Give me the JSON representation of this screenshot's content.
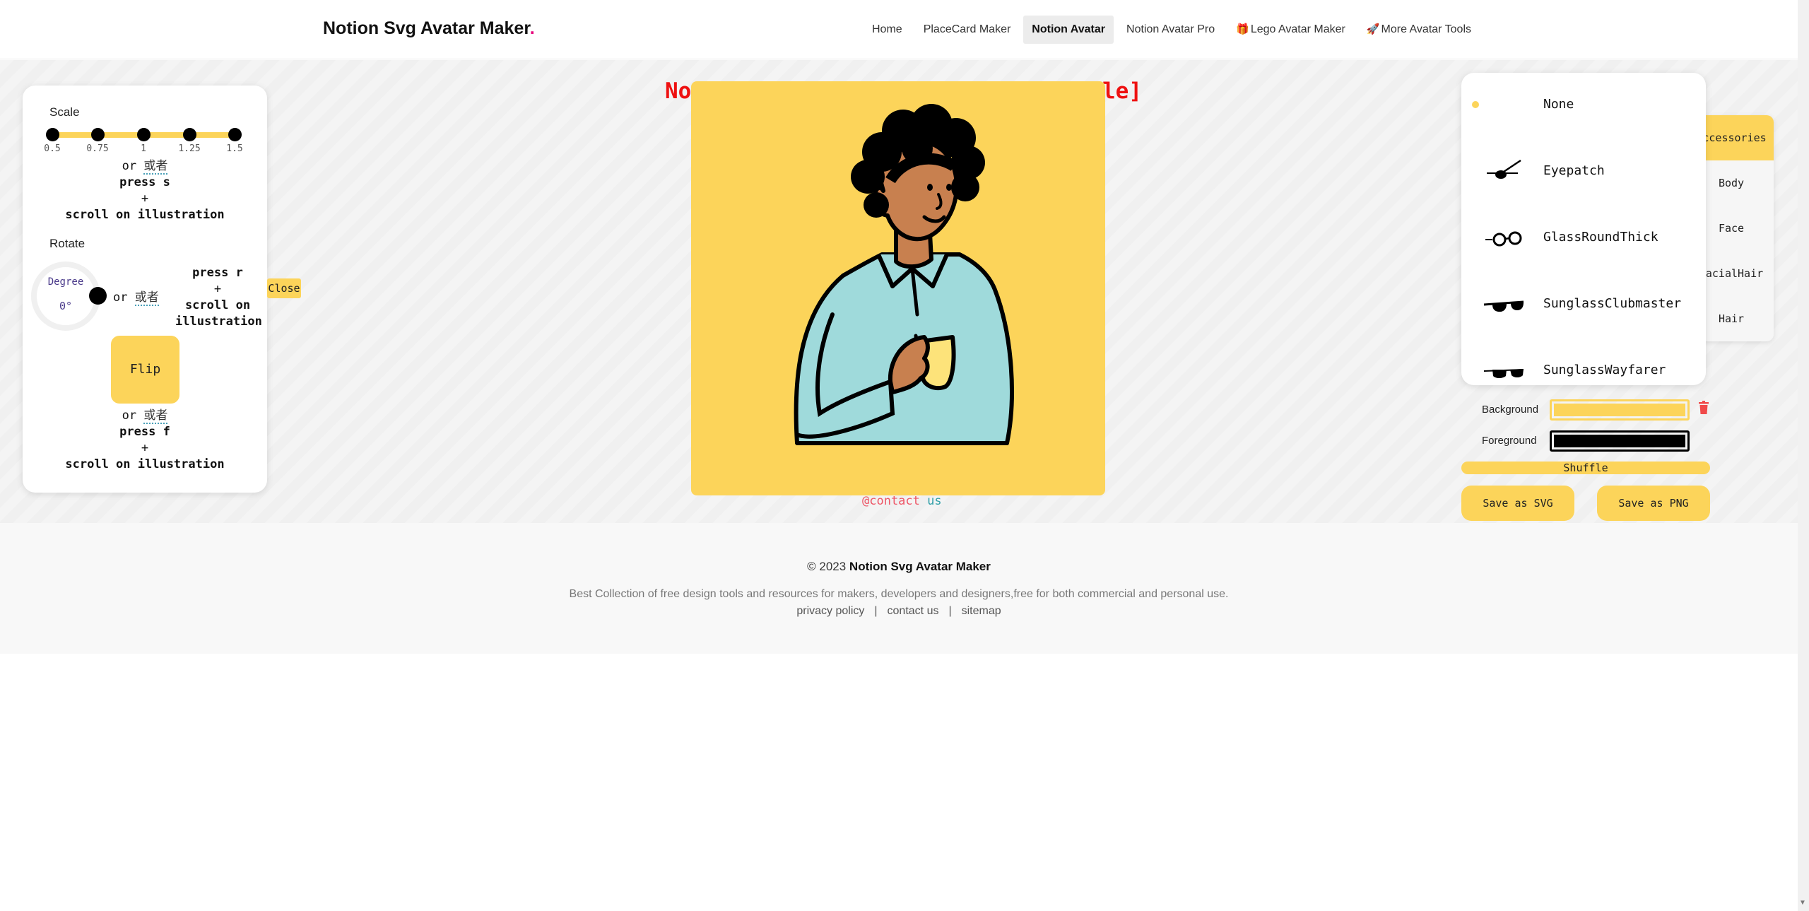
{
  "header": {
    "logo": "Notion Svg Avatar Maker",
    "logo_dot": ".",
    "nav": [
      {
        "label": "Home",
        "icon": ""
      },
      {
        "label": "PlaceCard Maker",
        "icon": ""
      },
      {
        "label": "Notion Avatar",
        "icon": "",
        "active": true
      },
      {
        "label": "Notion Avatar Pro",
        "icon": ""
      },
      {
        "label": "Lego Avatar Maker",
        "icon": "🎁"
      },
      {
        "label": "More Avatar Tools",
        "icon": "🚀"
      }
    ]
  },
  "left_panel": {
    "scale_label": "Scale",
    "scale_ticks": [
      "0.5",
      "0.75",
      "1",
      "1.25",
      "1.5"
    ],
    "scale_or": "or",
    "scale_or_cn": "或者",
    "scale_press": "press s",
    "scale_plus": "+",
    "scale_scroll": "scroll on illustration",
    "rotate_label": "Rotate",
    "degree_label": "Degree",
    "degree_value": "0°",
    "rotate_or": "or",
    "rotate_or_cn": "或者",
    "rotate_press": "press r",
    "rotate_plus": "+",
    "rotate_scroll1": "scroll on",
    "rotate_scroll2": "illustration",
    "flip_label": "Flip",
    "flip_or": "or",
    "flip_or_cn": "或者",
    "flip_press": "press f",
    "flip_plus": "+",
    "flip_scroll": "scroll on illustration",
    "close_label": "Close"
  },
  "canvas": {
    "title_start": "Not",
    "title_end": "le]",
    "contact_at": "@contact",
    "contact_us": " us",
    "background_color": "#fcd45a"
  },
  "right_panel": {
    "categories": [
      "Accessories",
      "Body",
      "Face",
      "FacialHair",
      "Hair"
    ],
    "active_category": "Accessories",
    "options": [
      "None",
      "Eyepatch",
      "GlassRoundThick",
      "SunglassClubmaster",
      "SunglassWayfarer"
    ],
    "selected_option": "None",
    "background_label": "Background",
    "background_color": "#fcd45a",
    "foreground_label": "Foreground",
    "foreground_color": "#000000",
    "shuffle_label": "Shuffle",
    "save_svg_label": "Save as SVG",
    "save_png_label": "Save as PNG"
  },
  "footer": {
    "copyright_prefix": "© 2023",
    "copyright_brand": "Notion Svg Avatar Maker",
    "description": "Best Collection of free design tools and resources for makers, developers and designers,free for both commercial and personal use.",
    "links": [
      "privacy policy",
      "contact us",
      "sitemap"
    ],
    "separator": "|"
  },
  "colors": {
    "accent": "#fcd45a",
    "title_red": "#ee1111",
    "brand_pink": "#e6007a"
  }
}
